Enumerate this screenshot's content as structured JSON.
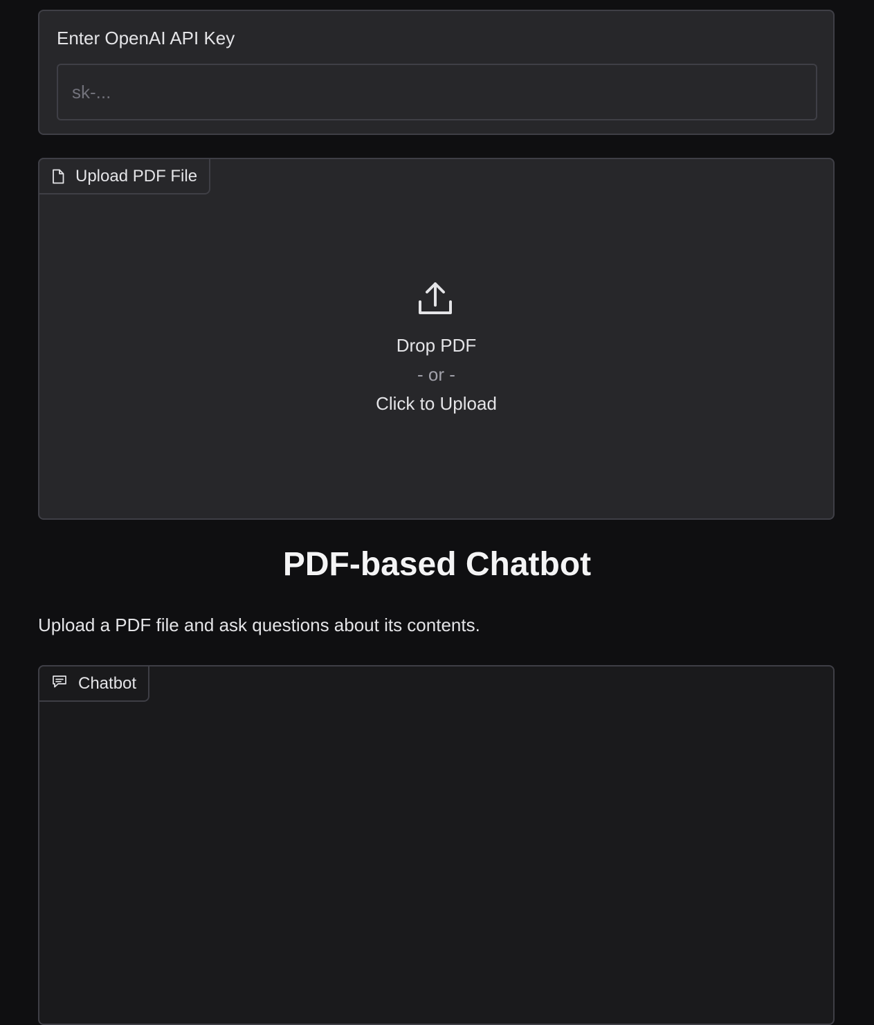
{
  "api_key": {
    "label": "Enter OpenAI API Key",
    "placeholder": "sk-...",
    "value": ""
  },
  "upload": {
    "tab_label": "Upload PDF File",
    "tab_icon": "file-icon",
    "icon": "upload-icon",
    "drop_text": "Drop PDF",
    "or_text": "- or -",
    "click_text": "Click to Upload"
  },
  "header": {
    "title": "PDF-based Chatbot",
    "description": "Upload a PDF file and ask questions about its contents."
  },
  "chatbot": {
    "tab_label": "Chatbot",
    "tab_icon": "chat-icon",
    "messages": []
  },
  "colors": {
    "page_background": "#0f0f11",
    "panel_background": "#27272a",
    "chat_background": "#1a1a1c",
    "border": "#3f3f46",
    "text": "#e4e4e7",
    "muted_text": "#71717a"
  }
}
